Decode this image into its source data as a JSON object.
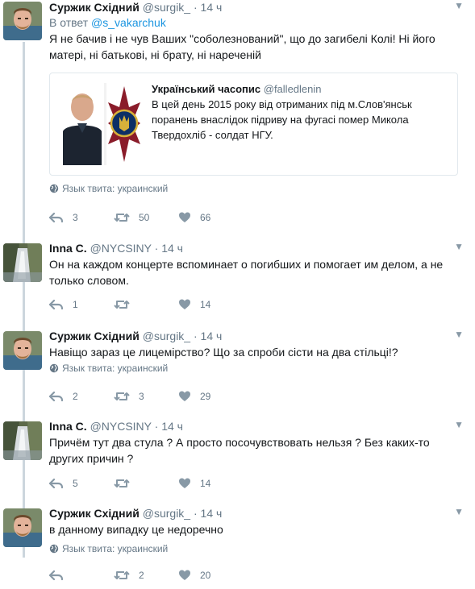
{
  "language_label": "Язык твита: украинский",
  "tweets": [
    {
      "name": "Суржик Східний",
      "handle": "@surgik_",
      "time": "14 ч",
      "reply_prefix": "В ответ",
      "reply_to": "@s_vakarchuk",
      "text": "Я не бачив і не чув Ваших \"соболезнований\", що до загибелі Колі! Ні його матері, ні батькові, ні брату, ні нареченій",
      "quote": {
        "name": "Український часопис",
        "handle": "@falledlenin",
        "text": "В цей день 2015 року від отриманих під м.Слов'янськ поранень внаслідок підриву на фугасі помер Микола Твердохліб - солдат НГУ."
      },
      "replies": "3",
      "retweets": "50",
      "likes": "66"
    },
    {
      "name": "Inna C.",
      "handle": "@NYCSINY",
      "time": "14 ч",
      "text": "Он на каждом концерте вспоминает о погибших и помогает им делом, а не только словом.",
      "replies": "1",
      "retweets": "",
      "likes": "14"
    },
    {
      "name": "Суржик Східний",
      "handle": "@surgik_",
      "time": "14 ч",
      "text": "Навіщо зараз це лицемірство? Що за спроби сісти на два стільці!?",
      "replies": "2",
      "retweets": "3",
      "likes": "29"
    },
    {
      "name": "Inna C.",
      "handle": "@NYCSINY",
      "time": "14 ч",
      "text": "Причём тут два стула ?  А просто посочувствовать нельзя ?  Без каких-то других причин ?",
      "replies": "5",
      "retweets": "",
      "likes": "14"
    },
    {
      "name": "Суржик Східний",
      "handle": "@surgik_",
      "time": "14 ч",
      "text": "в данному випадку це недоречно",
      "replies": "",
      "retweets": "2",
      "likes": "20"
    }
  ],
  "colors": {
    "text": "#14171a",
    "muted": "#657786",
    "link": "#1b95e0",
    "border": "#e1e8ed",
    "thread_line": "#ccd6dd"
  }
}
